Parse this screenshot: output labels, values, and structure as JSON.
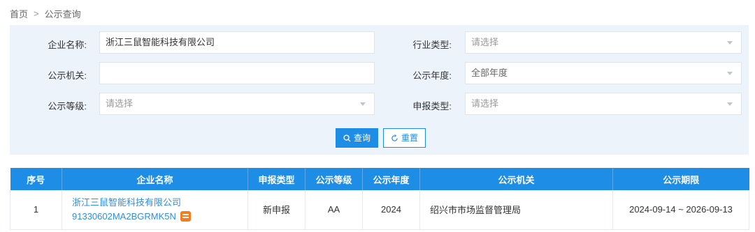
{
  "breadcrumb": {
    "home": "首页",
    "separator": ">",
    "current": "公示查询"
  },
  "form": {
    "company_name": {
      "label": "企业名称:",
      "value": "浙江三鼠智能科技有限公司"
    },
    "industry_type": {
      "label": "行业类型:",
      "value": "请选择"
    },
    "authority": {
      "label": "公示机关:",
      "value": ""
    },
    "year": {
      "label": "公示年度:",
      "value": "全部年度"
    },
    "level": {
      "label": "公示等级:",
      "value": "请选择"
    },
    "report_type": {
      "label": "申报类型:",
      "value": "请选择"
    },
    "search_button": "查询",
    "reset_button": "重置"
  },
  "table": {
    "headers": [
      "序号",
      "企业名称",
      "申报类型",
      "公示等级",
      "公示年度",
      "公示机关",
      "公示期限"
    ],
    "rows": [
      {
        "index": "1",
        "company": "浙江三鼠智能科技有限公司",
        "credit_code": "91330602MA2BGRMK5N",
        "report_type": "新申报",
        "level": "AA",
        "year": "2024",
        "authority": "绍兴市市场监督管理局",
        "period": "2024-09-14 ~ 2026-09-13"
      }
    ]
  },
  "colors": {
    "accent": "#1e8de6",
    "panel_bg": "#edf3fb",
    "link": "#2f8fde",
    "badge": "#f57c1f"
  }
}
